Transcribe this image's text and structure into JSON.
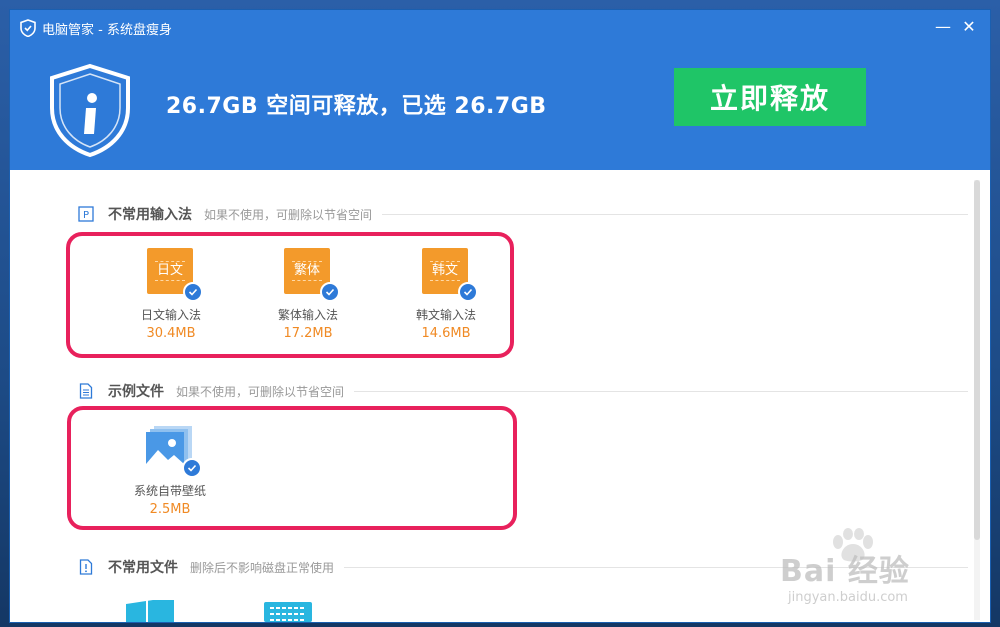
{
  "window": {
    "title": "电脑管家 - 系统盘瘦身",
    "minimize_glyph": "—",
    "close_glyph": "✕"
  },
  "header": {
    "headline": "26.7GB 空间可释放，已选 26.7GB",
    "release_button": "立即释放"
  },
  "sections": [
    {
      "title": "不常用输入法",
      "desc": "如果不使用，可删除以节省空间",
      "icon": "p-box-icon",
      "items": [
        {
          "icon_text": "日文",
          "name": "日文输入法",
          "size": "30.4MB",
          "checked": true
        },
        {
          "icon_text": "繁体",
          "name": "繁体输入法",
          "size": "17.2MB",
          "checked": true
        },
        {
          "icon_text": "韩文",
          "name": "韩文输入法",
          "size": "14.6MB",
          "checked": true
        }
      ]
    },
    {
      "title": "示例文件",
      "desc": "如果不使用，可删除以节省空间",
      "icon": "document-icon",
      "items": [
        {
          "icon": "image-stack-icon",
          "name": "系统自带壁纸",
          "size": "2.5MB",
          "checked": true
        }
      ]
    },
    {
      "title": "不常用文件",
      "desc": "删除后不影响磁盘正常使用",
      "icon": "file-alert-icon"
    }
  ],
  "watermark": {
    "big": "Bai 经验",
    "small": "jingyan.baidu.com"
  },
  "colors": {
    "header_blue": "#2e7ad8",
    "release_green": "#1fc567",
    "ime_orange": "#f39a2b",
    "size_orange": "#f08a24",
    "highlight_pink": "#e8215c"
  }
}
